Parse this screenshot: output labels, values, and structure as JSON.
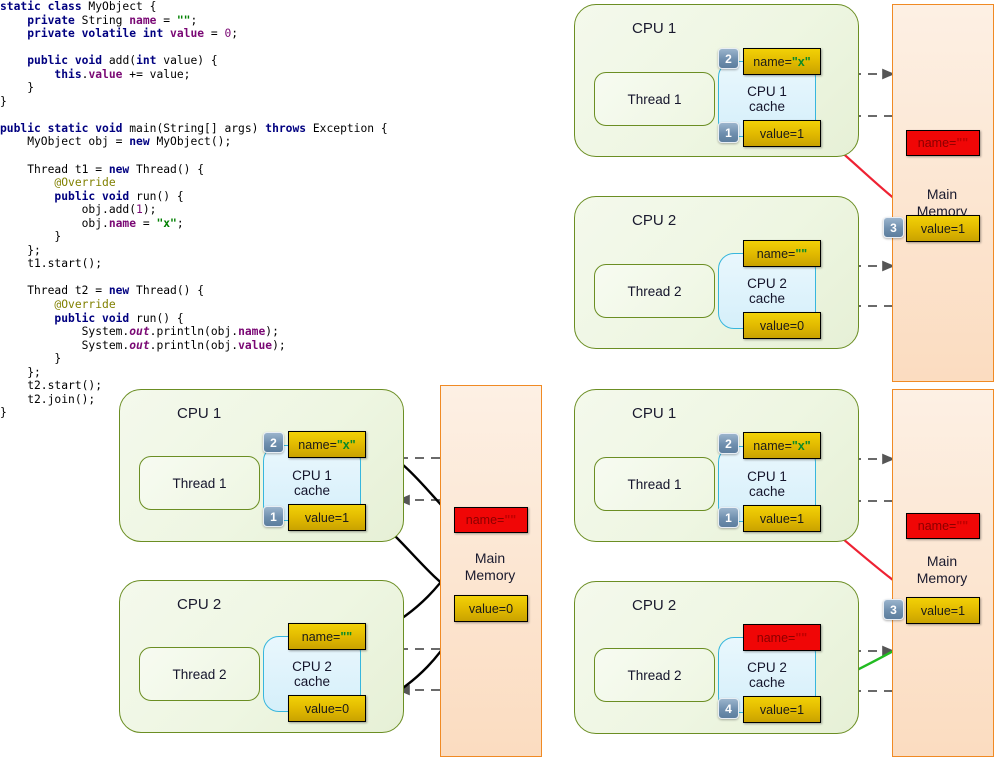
{
  "code": {
    "language": "java",
    "lines": [
      [
        {
          "t": "static ",
          "c": "k"
        },
        {
          "t": "class ",
          "c": "k"
        },
        {
          "t": "MyObject {",
          "c": ""
        }
      ],
      [
        {
          "t": "    ",
          "c": ""
        },
        {
          "t": "private ",
          "c": "k"
        },
        {
          "t": "String ",
          "c": ""
        },
        {
          "t": "name",
          "c": "f"
        },
        {
          "t": " = ",
          "c": ""
        },
        {
          "t": "\"\"",
          "c": "s"
        },
        {
          "t": ";",
          "c": ""
        }
      ],
      [
        {
          "t": "    ",
          "c": ""
        },
        {
          "t": "private volatile int ",
          "c": "k"
        },
        {
          "t": "value",
          "c": "f"
        },
        {
          "t": " = ",
          "c": ""
        },
        {
          "t": "0",
          "c": "n"
        },
        {
          "t": ";",
          "c": ""
        }
      ],
      [],
      [
        {
          "t": "    ",
          "c": ""
        },
        {
          "t": "public void ",
          "c": "k"
        },
        {
          "t": "add(",
          "c": ""
        },
        {
          "t": "int ",
          "c": "k"
        },
        {
          "t": "value) {",
          "c": ""
        }
      ],
      [
        {
          "t": "        ",
          "c": ""
        },
        {
          "t": "this",
          "c": "k"
        },
        {
          "t": ".",
          "c": ""
        },
        {
          "t": "value",
          "c": "f"
        },
        {
          "t": " += value;",
          "c": ""
        }
      ],
      [
        {
          "t": "    }",
          "c": ""
        }
      ],
      [
        {
          "t": "}",
          "c": ""
        }
      ],
      [],
      [
        {
          "t": "public static void ",
          "c": "k"
        },
        {
          "t": "main(String[] args) ",
          "c": ""
        },
        {
          "t": "throws ",
          "c": "k"
        },
        {
          "t": "Exception {",
          "c": ""
        }
      ],
      [
        {
          "t": "    MyObject obj = ",
          "c": ""
        },
        {
          "t": "new ",
          "c": "k"
        },
        {
          "t": "MyObject();",
          "c": ""
        }
      ],
      [],
      [
        {
          "t": "    Thread t1 = ",
          "c": ""
        },
        {
          "t": "new ",
          "c": "k"
        },
        {
          "t": "Thread() {",
          "c": ""
        }
      ],
      [
        {
          "t": "        ",
          "c": ""
        },
        {
          "t": "@Override",
          "c": "a"
        }
      ],
      [
        {
          "t": "        ",
          "c": ""
        },
        {
          "t": "public void ",
          "c": "k"
        },
        {
          "t": "run() {",
          "c": ""
        }
      ],
      [
        {
          "t": "            obj.add(",
          "c": ""
        },
        {
          "t": "1",
          "c": "n"
        },
        {
          "t": ");",
          "c": ""
        }
      ],
      [
        {
          "t": "            obj.",
          "c": ""
        },
        {
          "t": "name",
          "c": "f"
        },
        {
          "t": " = ",
          "c": ""
        },
        {
          "t": "\"x\"",
          "c": "s"
        },
        {
          "t": ";",
          "c": ""
        }
      ],
      [
        {
          "t": "        }",
          "c": ""
        }
      ],
      [
        {
          "t": "    };",
          "c": ""
        }
      ],
      [
        {
          "t": "    t1.start();",
          "c": ""
        }
      ],
      [],
      [
        {
          "t": "    Thread t2 = ",
          "c": ""
        },
        {
          "t": "new ",
          "c": "k"
        },
        {
          "t": "Thread() {",
          "c": ""
        }
      ],
      [
        {
          "t": "        ",
          "c": ""
        },
        {
          "t": "@Override",
          "c": "a"
        }
      ],
      [
        {
          "t": "        ",
          "c": ""
        },
        {
          "t": "public void ",
          "c": "k"
        },
        {
          "t": "run() {",
          "c": ""
        }
      ],
      [
        {
          "t": "            System.",
          "c": ""
        },
        {
          "t": "out",
          "c": "i"
        },
        {
          "t": ".println(obj.",
          "c": ""
        },
        {
          "t": "name",
          "c": "f"
        },
        {
          "t": ");",
          "c": ""
        }
      ],
      [
        {
          "t": "            System.",
          "c": ""
        },
        {
          "t": "out",
          "c": "i"
        },
        {
          "t": ".println(obj.",
          "c": ""
        },
        {
          "t": "value",
          "c": "f"
        },
        {
          "t": ");",
          "c": ""
        }
      ],
      [
        {
          "t": "        }",
          "c": ""
        }
      ],
      [
        {
          "t": "    };",
          "c": ""
        }
      ],
      [
        {
          "t": "    t2.start();",
          "c": ""
        }
      ],
      [
        {
          "t": "    t2.join();",
          "c": ""
        }
      ],
      [
        {
          "t": "}",
          "c": ""
        }
      ]
    ]
  },
  "colors": {
    "cpu_border": "#6b8e23",
    "cache_border": "#37b6dd",
    "memory_border": "#f08a24",
    "value_yellow": "#e0b800",
    "value_red": "#f00606",
    "badge_blue": "#6f8fae",
    "arrow_gray": "#555555",
    "arrow_red": "#ee2233",
    "arrow_green": "#22bb22",
    "arrow_black": "#000000",
    "string_green": "#0a8a28"
  },
  "diagrams": [
    {
      "id": "top-right",
      "cpus": [
        {
          "name": "CPU 1",
          "thread": "Thread 1",
          "cache_line1": "CPU 1",
          "cache_line2": "cache",
          "top_value": {
            "label_prefix": "name=",
            "label_quoted": "\"x\"",
            "style": "yellow",
            "badge": "2"
          },
          "bottom_value": {
            "label_prefix": "value=1",
            "label_quoted": "",
            "style": "yellow",
            "badge": "1"
          }
        },
        {
          "name": "CPU 2",
          "thread": "Thread 2",
          "cache_line1": "CPU 2",
          "cache_line2": "cache",
          "top_value": {
            "label_prefix": "name=",
            "label_quoted": "\"\"",
            "style": "yellow",
            "badge": ""
          },
          "bottom_value": {
            "label_prefix": "value=0",
            "label_quoted": "",
            "style": "yellow",
            "badge": ""
          }
        }
      ],
      "memory": {
        "title_line1": "Main",
        "title_line2": "Memory",
        "top_value": {
          "label_prefix": "name=",
          "label_quoted": "\"\"",
          "style": "red",
          "badge": ""
        },
        "bottom_value": {
          "label_prefix": "value=1",
          "label_quoted": "",
          "style": "yellow",
          "badge": "3"
        }
      },
      "special_arrows": [
        {
          "kind": "red-curve",
          "from": "cpu1-cache-value",
          "to": "memory-value"
        }
      ]
    },
    {
      "id": "bottom-left",
      "cpus": [
        {
          "name": "CPU 1",
          "thread": "Thread 1",
          "cache_line1": "CPU 1",
          "cache_line2": "cache",
          "top_value": {
            "label_prefix": "name=",
            "label_quoted": "\"x\"",
            "style": "yellow",
            "badge": "2"
          },
          "bottom_value": {
            "label_prefix": "value=1",
            "label_quoted": "",
            "style": "yellow",
            "badge": "1"
          }
        },
        {
          "name": "CPU 2",
          "thread": "Thread 2",
          "cache_line1": "CPU 2",
          "cache_line2": "cache",
          "top_value": {
            "label_prefix": "name=",
            "label_quoted": "\"\"",
            "style": "yellow",
            "badge": ""
          },
          "bottom_value": {
            "label_prefix": "value=0",
            "label_quoted": "",
            "style": "yellow",
            "badge": ""
          }
        }
      ],
      "memory": {
        "title_line1": "Main",
        "title_line2": "Memory",
        "top_value": {
          "label_prefix": "name=",
          "label_quoted": "\"\"",
          "style": "red",
          "badge": ""
        },
        "bottom_value": {
          "label_prefix": "value=0",
          "label_quoted": "",
          "style": "yellow",
          "badge": ""
        }
      },
      "special_arrows": [
        {
          "kind": "black-curve",
          "from": "memory-name",
          "to": "cpu1-cache-name"
        },
        {
          "kind": "black-curve",
          "from": "memory-value",
          "to": "cpu1-cache-value"
        },
        {
          "kind": "black-curve",
          "from": "memory-name",
          "to": "cpu2-cache-name"
        },
        {
          "kind": "black-curve",
          "from": "memory-value",
          "to": "cpu2-cache-value"
        }
      ]
    },
    {
      "id": "bottom-right",
      "cpus": [
        {
          "name": "CPU 1",
          "thread": "Thread 1",
          "cache_line1": "CPU 1",
          "cache_line2": "cache",
          "top_value": {
            "label_prefix": "name=",
            "label_quoted": "\"x\"",
            "style": "yellow",
            "badge": "2"
          },
          "bottom_value": {
            "label_prefix": "value=1",
            "label_quoted": "",
            "style": "yellow",
            "badge": "1"
          }
        },
        {
          "name": "CPU 2",
          "thread": "Thread 2",
          "cache_line1": "CPU 2",
          "cache_line2": "cache",
          "top_value": {
            "label_prefix": "name=",
            "label_quoted": "\"\"",
            "style": "red",
            "badge": ""
          },
          "bottom_value": {
            "label_prefix": "value=1",
            "label_quoted": "",
            "style": "yellow",
            "badge": "4"
          }
        }
      ],
      "memory": {
        "title_line1": "Main",
        "title_line2": "Memory",
        "top_value": {
          "label_prefix": "name=",
          "label_quoted": "\"\"",
          "style": "red",
          "badge": ""
        },
        "bottom_value": {
          "label_prefix": "value=1",
          "label_quoted": "",
          "style": "yellow",
          "badge": "3"
        }
      },
      "special_arrows": [
        {
          "kind": "red-curve",
          "from": "cpu1-cache-value",
          "to": "memory-value"
        },
        {
          "kind": "green-curve",
          "from": "memory-value",
          "to": "cpu2-cache-value"
        }
      ]
    }
  ]
}
